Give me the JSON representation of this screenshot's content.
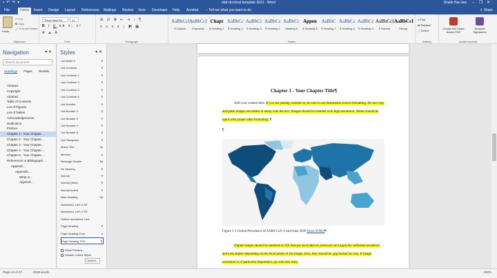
{
  "window": {
    "title": "etdr-doctoral-template-2021 - Word",
    "user": "Shalin Hai-Jew",
    "qat_icons": [
      "save-icon",
      "undo-icon",
      "redo-icon",
      "customize-icon"
    ],
    "controls": [
      "minimize-icon",
      "restore-icon",
      "close-icon"
    ]
  },
  "ribbon_tabs": [
    "File",
    "Home",
    "Insert",
    "Design",
    "Layout",
    "References",
    "Mailings",
    "Review",
    "View",
    "Developer",
    "Help",
    "Acrobat"
  ],
  "active_tab": "Home",
  "tell_me": "Tell me what you want to do",
  "share_label": "Share",
  "clipboard": {
    "paste": "Paste",
    "cut": "Cut",
    "copy": "Copy",
    "format_painter": "Format Painter",
    "group": "Clipboard"
  },
  "font": {
    "name": "Times New Ro",
    "size": "12",
    "group": "Font"
  },
  "paragraph_group": "Paragraph",
  "styles_gallery": [
    {
      "sample": "AaBbCcI",
      "name": "¶ Caption"
    },
    {
      "sample": "AaBbCcI",
      "name": "Emphasis"
    },
    {
      "sample": "Chapt",
      "name": "¶ Heading 1"
    },
    {
      "sample": "AaBbCc",
      "name": "¶ Heading 2"
    },
    {
      "sample": "AaBbCc",
      "name": "¶ Heading 3"
    },
    {
      "sample": "AaBbCc",
      "name": "¶ Heading 4"
    },
    {
      "sample": "AaBbCc",
      "name": "Heading 5"
    },
    {
      "sample": "Appen",
      "name": "¶ Heading 6"
    },
    {
      "sample": "AaBbC",
      "name": "¶ Heading 7"
    },
    {
      "sample": "AaBbCc",
      "name": "¶ Heading 8"
    },
    {
      "sample": "AaBbCc",
      "name": "¶ Heading 9"
    },
    {
      "sample": "AaBbCcI",
      "name": "¶ Normal"
    },
    {
      "sample": "AaBbCcI",
      "name": "Strong"
    }
  ],
  "styles_group": "Styles",
  "editing": {
    "find": "Find",
    "replace": "Replace",
    "select": "Select",
    "group": "Editing"
  },
  "acrobat": {
    "create_share": "Create and Share Adobe PDF",
    "request_sig": "Request Signatures",
    "group": "Adobe Acrobat"
  },
  "navigation": {
    "title": "Navigation",
    "search_placeholder": "Search document",
    "tabs": [
      "Headings",
      "Pages",
      "Results"
    ],
    "items": [
      {
        "label": "Abstract",
        "indent": 1,
        "sel": false
      },
      {
        "label": "Copyright",
        "indent": 1,
        "sel": false
      },
      {
        "label": "Abstract",
        "indent": 1,
        "sel": false
      },
      {
        "label": "Table of Contents",
        "indent": 1,
        "sel": false
      },
      {
        "label": "List of Figures",
        "indent": 1,
        "sel": false
      },
      {
        "label": "List of Tables",
        "indent": 1,
        "sel": false
      },
      {
        "label": "Acknowledgements",
        "indent": 1,
        "sel": false
      },
      {
        "label": "Dedication",
        "indent": 1,
        "sel": false
      },
      {
        "label": "Preface",
        "indent": 1,
        "sel": false
      },
      {
        "label": "Chapter 1 - Your Chapter…",
        "indent": 1,
        "sel": true
      },
      {
        "label": "Chapter 2 - Your Chapter…",
        "indent": 1,
        "sel": false
      },
      {
        "label": "Chapter 3 - Your Chapter…",
        "indent": 1,
        "sel": false
      },
      {
        "label": "Chapter 4 - Your Chapter…",
        "indent": 1,
        "sel": false
      },
      {
        "label": "Chapter 5 - Your Chapter…",
        "indent": 1,
        "sel": false
      },
      {
        "label": "References or Bibliograph…",
        "indent": 1,
        "sel": false
      },
      {
        "label": "Appendi…",
        "indent": 2,
        "sel": false
      },
      {
        "label": "Appendix…",
        "indent": 3,
        "sel": false
      },
      {
        "label": "What is…",
        "indent": 4,
        "sel": false
      },
      {
        "label": "Appendi…",
        "indent": 4,
        "sel": false
      }
    ]
  },
  "styles_pane": {
    "title": "Styles",
    "items": [
      {
        "label": "List Bullet 3",
        "mark": "¶"
      },
      {
        "label": "List Continue",
        "mark": "¶"
      },
      {
        "label": "List Continue 2",
        "mark": "¶"
      },
      {
        "label": "List Continue 3",
        "mark": "¶"
      },
      {
        "label": "List Continue 4",
        "mark": "¶"
      },
      {
        "label": "List Continue 5",
        "mark": "¶"
      },
      {
        "label": "List Number",
        "mark": "¶"
      },
      {
        "label": "List Number 2",
        "mark": "¶"
      },
      {
        "label": "List Number 3",
        "mark": "¶"
      },
      {
        "label": "List Number 4",
        "mark": "¶"
      },
      {
        "label": "List Number 5",
        "mark": "¶"
      },
      {
        "label": "List Paragraph",
        "mark": "¶"
      },
      {
        "label": "Macro Text",
        "mark": "¶a"
      },
      {
        "label": "Mention",
        "mark": "a"
      },
      {
        "label": "Message Header",
        "mark": "¶a"
      },
      {
        "label": "No Spacing",
        "mark": "¶"
      },
      {
        "label": "Normal",
        "mark": "¶"
      },
      {
        "label": "Normal (Web)",
        "mark": "¶"
      },
      {
        "label": "Normal Indent",
        "mark": "¶"
      },
      {
        "label": "Note Heading",
        "mark": "¶a"
      },
      {
        "label": "Numbered, Left: 0.25\",",
        "mark": ""
      },
      {
        "label": "Numbered, Left: 0.75\",",
        "mark": ""
      },
      {
        "label": "Outline numbered, Left:",
        "mark": ""
      },
      {
        "label": "Page Heading",
        "mark": "¶"
      },
      {
        "label": "Page Heading Char",
        "mark": "a"
      },
      {
        "label": "Page Heading TOC",
        "mark": "¶"
      }
    ],
    "selected_index": 25,
    "show_preview": "Show Preview",
    "disable_linked": "Disable Linked Styles",
    "options_button": "Options..."
  },
  "document": {
    "heading": "Chapter 1 - Your Chapter Title¶",
    "para1_plain": "Add your content here. ",
    "para1_hl": "If you are pasting contents in, be sure to use destination source formatting. Do not copy and paste images and tables in along with the text. Images should be inserted with high resolution. Tables should be input with proper table formatting.",
    "para1_end": "¶",
    "pilcrow": "¶",
    "caption_text": "Figure 1-1 Global Prevalence of SARS-CoV-2 mid-June 2020 ",
    "caption_link": "(from WHO)",
    "caption_end": "¶",
    "para2_hl": "Digital images should be rendered at 350 dots per inch (dpi) or pixels per inch (ppi) for sufficient resolution and even higher depending on the focal points of the image. Also, they should be .jpg format for size. If image resolution is of particular importance, go with less lossy"
  },
  "status": {
    "page": "Page 14 of 27",
    "words": "5158 words",
    "zoom": "100%"
  },
  "colors": {
    "accent": "#2b579a",
    "highlight": "#ffff00",
    "selection": "#c5d9f1",
    "map_ocean": "#f4f4f4",
    "map_land_dark": "#0e4c7a",
    "map_land_light": "#8ec7df"
  }
}
